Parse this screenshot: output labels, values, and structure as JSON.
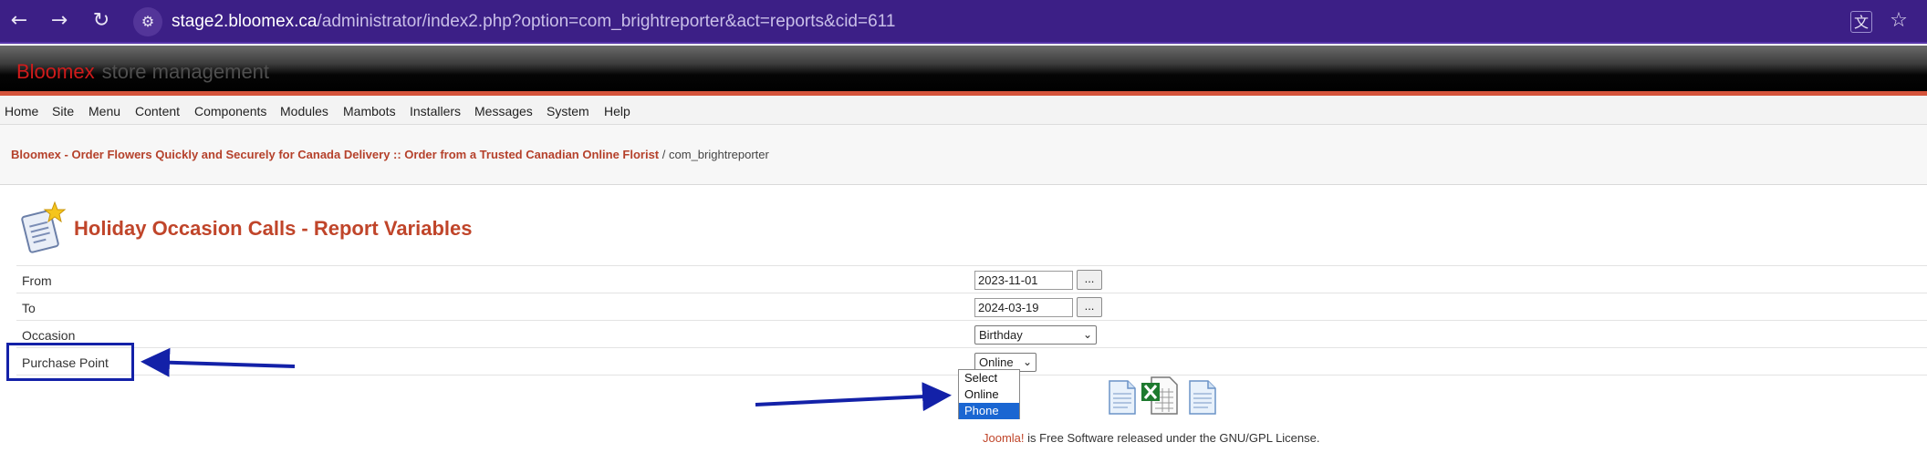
{
  "browser": {
    "url_host": "stage2.bloomex.ca",
    "url_path": "/administrator/index2.php?option=com_brightreporter&act=reports&cid=611"
  },
  "header": {
    "brand_red": "Bloomex",
    "brand_grey": "store management"
  },
  "menu": [
    "Home",
    "Site",
    "Menu",
    "Content",
    "Components",
    "Modules",
    "Mambots",
    "Installers",
    "Messages",
    "System",
    "Help"
  ],
  "breadcrumb": {
    "link": "Bloomex - Order Flowers Quickly and Securely for Canada Delivery :: Order from a Trusted Canadian Online Florist",
    "separator": "/",
    "current": "com_brightreporter"
  },
  "page_title": "Holiday Occasion Calls - Report Variables",
  "form": {
    "from_label": "From",
    "from_value": "2023-11-01",
    "to_label": "To",
    "to_value": "2024-03-19",
    "occasion_label": "Occasion",
    "occasion_value": "Birthday",
    "purchase_point_label": "Purchase Point",
    "purchase_point_value": "Online",
    "purchase_point_options": [
      "Select",
      "Online",
      "Phone"
    ],
    "purchase_point_highlighted": "Phone",
    "date_button_label": "..."
  },
  "footer": {
    "joomla": "Joomla!",
    "text": " is Free Software released under the GNU/GPL License."
  },
  "colors": {
    "accent": "#c0452a",
    "annotation": "#1321a8",
    "browser_bar": "#3c1f86"
  }
}
